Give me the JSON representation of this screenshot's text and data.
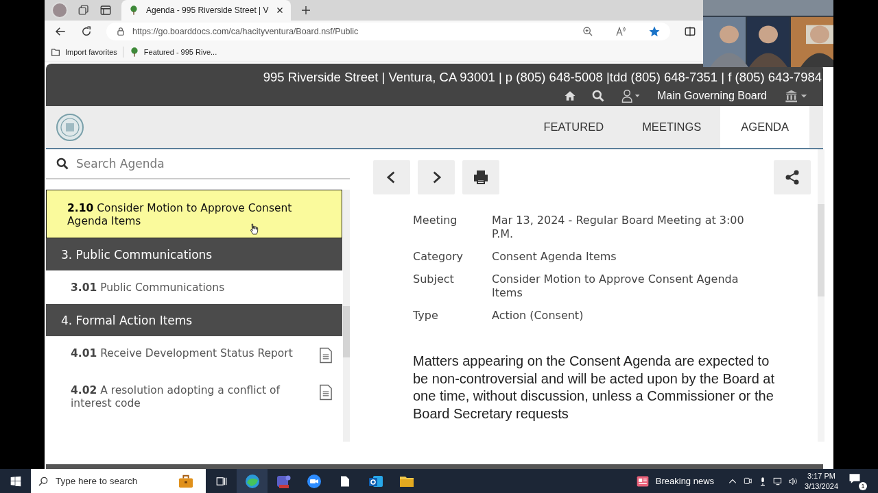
{
  "browser": {
    "tabs": [
      {
        "title": "Agenda - 995 Riverside Street | V",
        "selected": true
      }
    ],
    "url": "https://go.boarddocs.com/ca/hacityventura/Board.nsf/Public",
    "favorites": [
      "Import favorites",
      "Featured - 995 Rive..."
    ]
  },
  "header": {
    "contact": "995 Riverside Street | Ventura, CA 93001 | p (805) 648-5008 |tdd (805) 648-7351 | f (805) 643-7984",
    "board": "Main Governing Board"
  },
  "nav": [
    {
      "label": "FEATURED",
      "selected": false
    },
    {
      "label": "MEETINGS",
      "selected": false
    },
    {
      "label": "AGENDA",
      "selected": true
    }
  ],
  "search": {
    "placeholder": "Search Agenda"
  },
  "agenda": [
    {
      "kind": "item",
      "number": "2.10",
      "title": "Consider Motion to Approve Consent Agenda Items",
      "selected": true,
      "attachment": false
    },
    {
      "kind": "section",
      "title": "3. Public Communications"
    },
    {
      "kind": "item",
      "number": "3.01",
      "title": "Public Communications",
      "selected": false,
      "attachment": false
    },
    {
      "kind": "section",
      "title": "4. Formal Action Items"
    },
    {
      "kind": "item",
      "number": "4.01",
      "title": "Receive Development Status Report",
      "selected": false,
      "attachment": true
    },
    {
      "kind": "item",
      "number": "4.02",
      "title": "A resolution adopting a conflict of interest code",
      "selected": false,
      "attachment": true
    }
  ],
  "detail": {
    "fields": [
      {
        "label": "Meeting",
        "value": "Mar 13, 2024 - Regular Board Meeting at 3:00 P.M."
      },
      {
        "label": "Category",
        "value": "Consent Agenda Items"
      },
      {
        "label": "Subject",
        "value": "Consider Motion to Approve Consent Agenda Items"
      },
      {
        "label": "Type",
        "value": "Action (Consent)"
      }
    ],
    "description": "Matters appearing on the Consent Agenda are expected to be non-controversial and will be acted upon by the Board at one time, without discussion, unless a Commissioner or the Board Secretary requests"
  },
  "taskbar": {
    "search_placeholder": "Type here to search",
    "news": "Breaking news",
    "time": "3:17 PM",
    "date": "3/13/2024",
    "notifications": "1"
  }
}
